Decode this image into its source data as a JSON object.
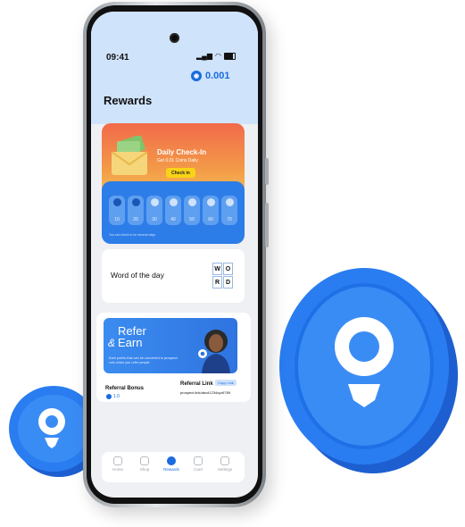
{
  "status_bar": {
    "time": "09:41"
  },
  "header": {
    "title": "Rewards",
    "coin_balance": "0.001"
  },
  "checkin": {
    "title": "Daily Check-In",
    "subtitle": "Get 0.01 Coins Daily",
    "button": "Check in"
  },
  "days": [
    {
      "value": "10",
      "done": true
    },
    {
      "value": "20",
      "done": true
    },
    {
      "value": "30",
      "done": false
    },
    {
      "value": "40",
      "done": false
    },
    {
      "value": "50",
      "done": false
    },
    {
      "value": "60",
      "done": false
    },
    {
      "value": "70",
      "done": false
    }
  ],
  "days_note": "You can check in for several days",
  "word_of_day": {
    "label": "Word of the day",
    "letters": [
      "W",
      "O",
      "R",
      "D"
    ]
  },
  "refer": {
    "line1": "Refer",
    "amp": "&",
    "line2": "Earn",
    "description": "Earn points that can be converted to prospect coin when you refer people",
    "bonus_label": "Referral Bonus",
    "bonus_value": "1.0",
    "link_label": "Referral Link",
    "copy_label": "Copy Link",
    "link_value": "prospect.link/abcd1234xyz6789"
  },
  "nav": [
    {
      "label": "Home",
      "active": false
    },
    {
      "label": "Shop",
      "active": false
    },
    {
      "label": "Rewards",
      "active": true
    },
    {
      "label": "Card",
      "active": false
    },
    {
      "label": "Settings",
      "active": false
    }
  ]
}
